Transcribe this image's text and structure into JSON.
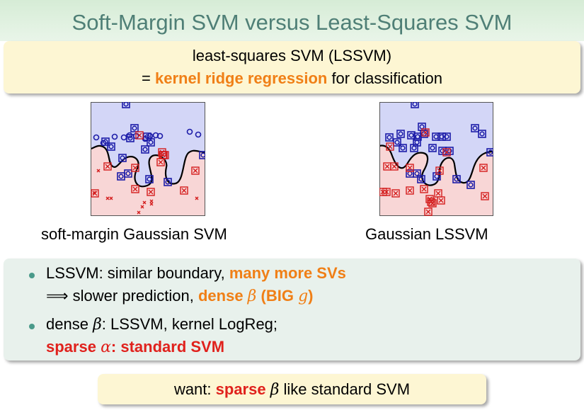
{
  "slide": {
    "title": "Soft-Margin SVM versus Least-Squares SVM",
    "box1": {
      "line1": "least-squares SVM (LSSVM)",
      "line2_prefix": "= ",
      "line2_emph": "kernel ridge regression",
      "line2_suffix": " for classification"
    },
    "captions": {
      "left": "soft-margin Gaussian SVM",
      "right": "Gaussian LSSVM"
    },
    "bullets": {
      "b1_text": "LSSVM: similar boundary, ",
      "b1_emph": "many more SVs",
      "b1_arrow": "⟹",
      "b1_l2_text": " slower prediction, ",
      "b1_l2_emph": "dense ",
      "beta": "β",
      "b1_l2_emph2": " (BIG ",
      "g": "g",
      "close_paren": ")",
      "b2_text": "dense ",
      "b2_text2": ": LSSVM, kernel LogReg;",
      "b2_emph": "sparse ",
      "alpha": "α",
      "b2_emph2": ": standard SVM"
    },
    "box2": {
      "prefix": "want: ",
      "emph": "sparse ",
      "suffix": " like standard SVM"
    },
    "colors": {
      "title": "#4f7f76",
      "orange_emphasis": "#f07f16",
      "red_emphasis": "#e0211c",
      "positive_class": "#1c1ca8",
      "negative_class": "#d41c1c",
      "region_blue": "#d3d6f7",
      "region_red": "#f8d6d6"
    }
  }
}
